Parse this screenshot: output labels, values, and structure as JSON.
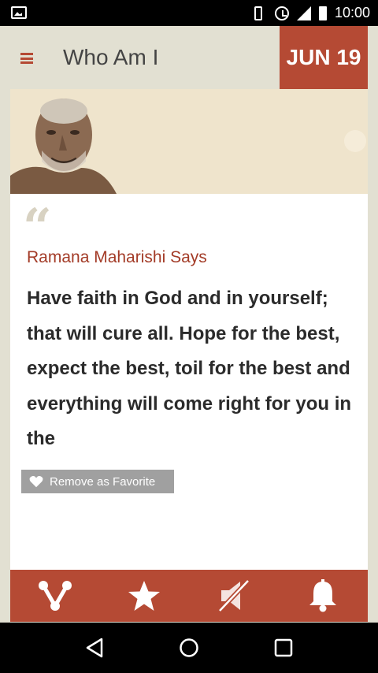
{
  "status_bar": {
    "time": "10:00",
    "icons": [
      "image-notification-icon",
      "vibrate-icon",
      "alarm-icon",
      "signal-icon",
      "battery-icon"
    ]
  },
  "app_bar": {
    "title": "Who Am I",
    "date": "JUN 19",
    "menu_icon": "hamburger-menu-icon"
  },
  "quote_card": {
    "quote_mark": "“",
    "speaker": "Ramana Maharishi Says",
    "text": "Have faith in God and in yourself; that will cure all. Hope for the best, expect the best, toil for the best and everything will come right for you in the",
    "favorite_button": "Remove as Favorite"
  },
  "bottom_bar": {
    "items": [
      {
        "icon": "share-icon"
      },
      {
        "icon": "star-icon"
      },
      {
        "icon": "mute-icon"
      },
      {
        "icon": "bell-icon"
      }
    ]
  },
  "nav_bar": {
    "items": [
      {
        "icon": "back-icon"
      },
      {
        "icon": "home-icon"
      },
      {
        "icon": "recents-icon"
      }
    ]
  },
  "colors": {
    "accent": "#b54a34",
    "background": "#e2e0d2",
    "banner": "#efe4cc",
    "favorite_button": "#a0a0a0"
  }
}
